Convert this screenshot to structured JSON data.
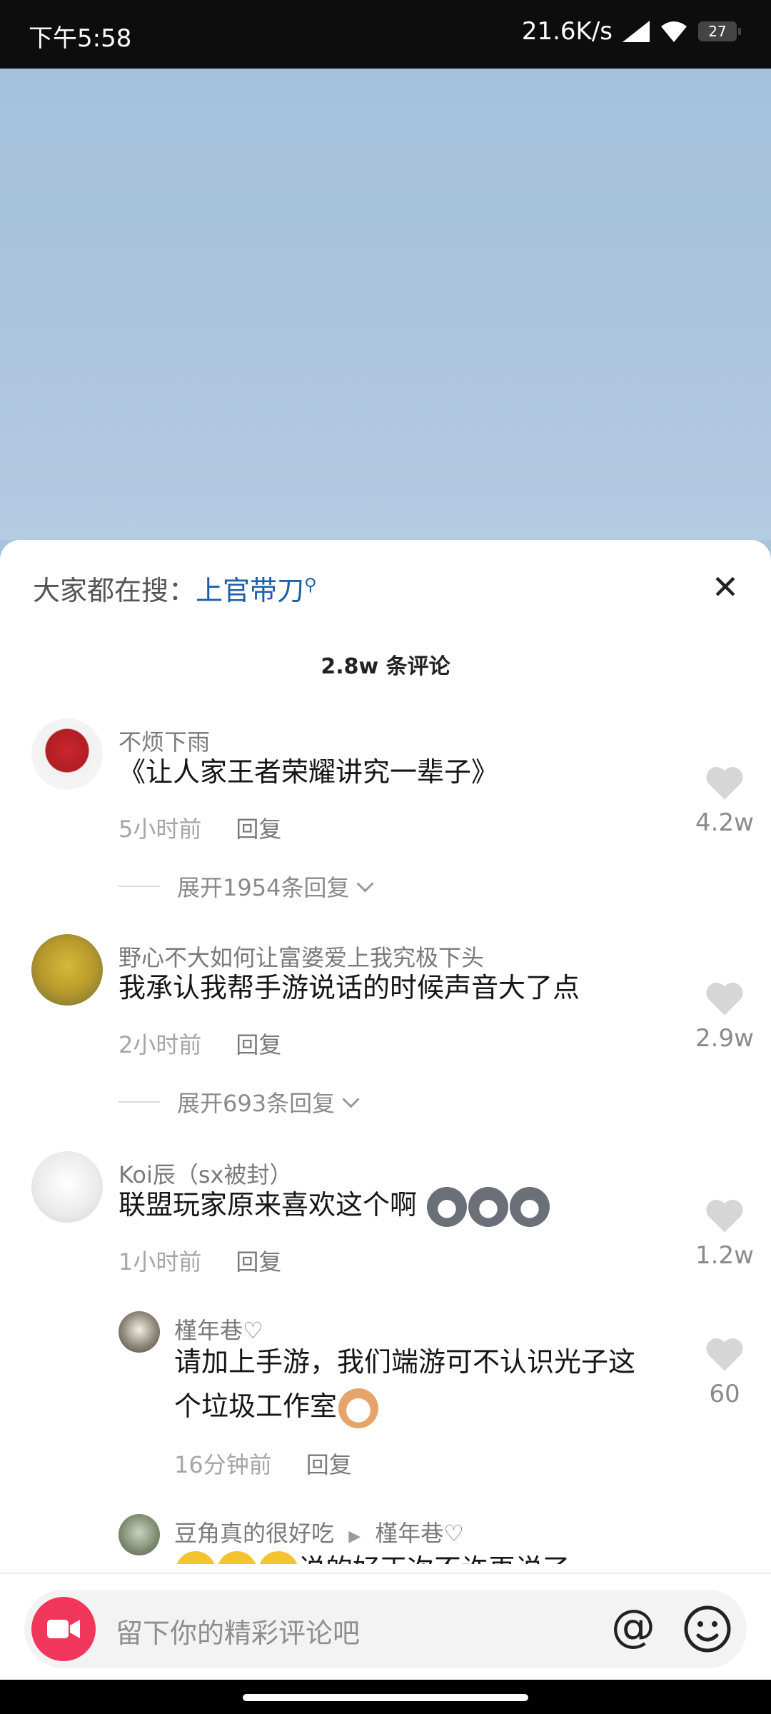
{
  "status": {
    "time": "下午5:58",
    "speed": "21.6K/s",
    "battery": "27"
  },
  "search": {
    "prefix": "大家都在搜：",
    "keyword": "上官带刀"
  },
  "comment_count": "2.8w 条评论",
  "comments": [
    {
      "user": "不烦下雨",
      "text": "《让人家王者荣耀讲究一辈子》",
      "time": "5小时前",
      "reply": "回复",
      "likes": "4.2w",
      "expand": "展开1954条回复"
    },
    {
      "user": "野心不大如何让富婆爱上我究极下头",
      "text": "我承认我帮手游说话的时候声音大了点",
      "time": "2小时前",
      "reply": "回复",
      "likes": "2.9w",
      "expand": "展开693条回复"
    },
    {
      "user": "Koi辰（sx被封）",
      "text": "联盟玩家原来喜欢这个啊",
      "time": "1小时前",
      "reply": "回复",
      "likes": "1.2w"
    }
  ],
  "replies": [
    {
      "user": "槿年巷♡",
      "text_line1": "请加上手游，我们端游可不认识光子这",
      "text_line2": "个垃圾工作室",
      "time": "16分钟前",
      "reply": "回复",
      "likes": "60"
    },
    {
      "user": "豆角真的很好吃",
      "reply_to": "槿年巷♡",
      "text": "说的好正次不许再说了"
    }
  ],
  "input": {
    "placeholder": "留下你的精彩评论吧",
    "at": "@"
  },
  "colors": {
    "accent": "#f0365a",
    "link": "#1f5fa8"
  }
}
